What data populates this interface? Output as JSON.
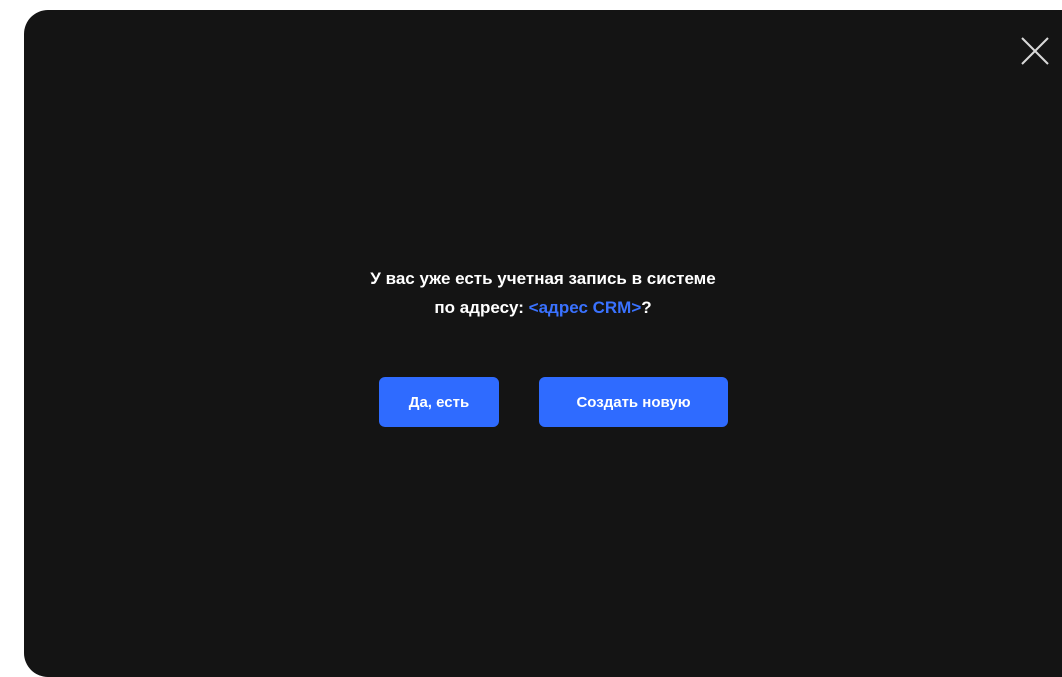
{
  "dialog": {
    "close_icon": "close-icon",
    "question_line1": "У вас уже есть учетная запись в системе",
    "question_line2_prefix": "по адресу: ",
    "crm_address": "<адрес CRM>",
    "question_line2_suffix": "?",
    "yes_button_label": "Да, есть",
    "create_button_label": "Создать новую"
  },
  "colors": {
    "modal_background": "#141414",
    "accent": "#2f6bff",
    "link": "#3a72ff",
    "text": "#ffffff"
  }
}
